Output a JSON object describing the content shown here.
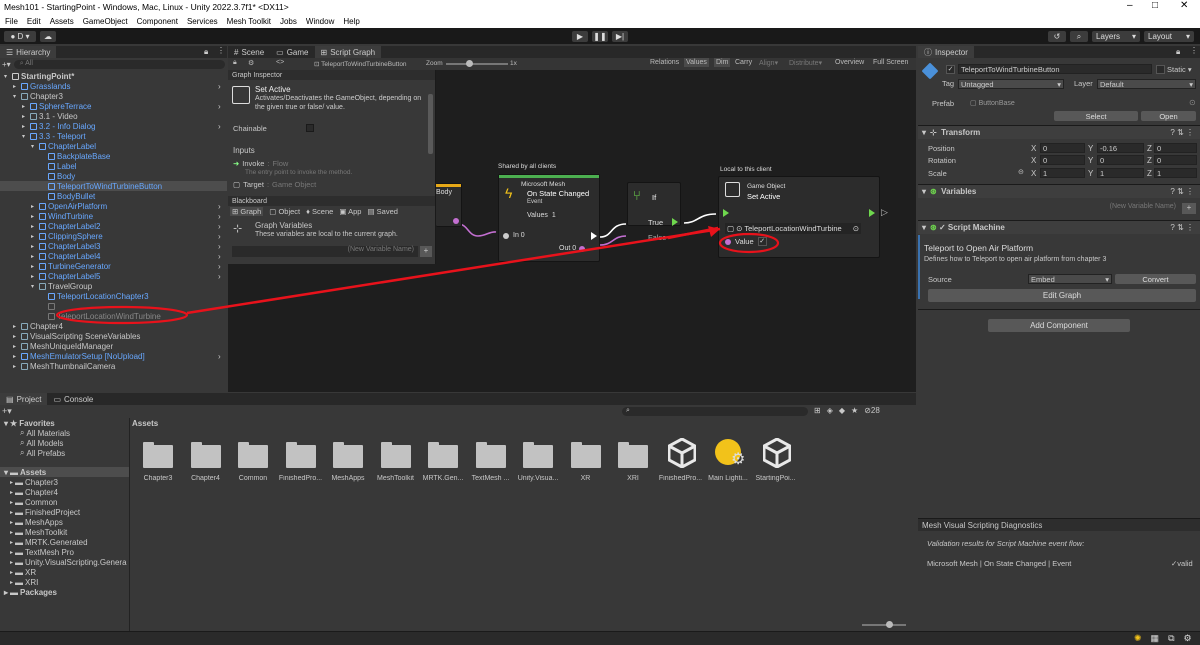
{
  "window": {
    "title": "Mesh101 - StartingPoint - Windows, Mac, Linux - Unity 2022.3.7f1* <DX11>",
    "min": "–",
    "max": "□",
    "close": "✕"
  },
  "menu": [
    "File",
    "Edit",
    "Assets",
    "GameObject",
    "Component",
    "Services",
    "Mesh Toolkit",
    "Jobs",
    "Window",
    "Help"
  ],
  "toolbar": {
    "account": "D",
    "layers": "Layers",
    "layout": "Layout"
  },
  "hierarchy": {
    "tab": "Hierarchy",
    "search_placeholder": "All",
    "rows": [
      {
        "label": "StartingPoint*",
        "indent": 0,
        "cls": "scene"
      },
      {
        "label": "Grasslands",
        "indent": 1,
        "cls": "blue"
      },
      {
        "label": "Chapter3",
        "indent": 1,
        "cls": ""
      },
      {
        "label": "SphereTerrace",
        "indent": 2,
        "cls": "blue"
      },
      {
        "label": "3.1 - Video",
        "indent": 2,
        "cls": ""
      },
      {
        "label": "3.2 - Info Dialog",
        "indent": 2,
        "cls": "blue"
      },
      {
        "label": "3.3 - Teleport",
        "indent": 2,
        "cls": "blue"
      },
      {
        "label": "ChapterLabel",
        "indent": 3,
        "cls": "blue"
      },
      {
        "label": "BackplateBase",
        "indent": 4,
        "cls": "blue"
      },
      {
        "label": "Label",
        "indent": 4,
        "cls": "blue"
      },
      {
        "label": "Body",
        "indent": 4,
        "cls": "blue"
      },
      {
        "label": "TeleportToWindTurbineButton",
        "indent": 4,
        "cls": "blue sel"
      },
      {
        "label": "BodyBullet",
        "indent": 4,
        "cls": "blue"
      },
      {
        "label": "OpenAirPlatform",
        "indent": 3,
        "cls": "blue"
      },
      {
        "label": "WindTurbine",
        "indent": 3,
        "cls": "blue"
      },
      {
        "label": "ChapterLabel2",
        "indent": 3,
        "cls": "blue"
      },
      {
        "label": "ClippingSphere",
        "indent": 3,
        "cls": "blue"
      },
      {
        "label": "ChapterLabel3",
        "indent": 3,
        "cls": "blue"
      },
      {
        "label": "ChapterLabel4",
        "indent": 3,
        "cls": "blue"
      },
      {
        "label": "TurbineGenerator",
        "indent": 3,
        "cls": "blue"
      },
      {
        "label": "ChapterLabel5",
        "indent": 3,
        "cls": "blue"
      },
      {
        "label": "TravelGroup",
        "indent": 3,
        "cls": ""
      },
      {
        "label": "TeleportLocationChapter3",
        "indent": 4,
        "cls": "blue"
      },
      {
        "label": "",
        "indent": 4,
        "cls": "gray"
      },
      {
        "label": "TeleportLocationWindTurbine",
        "indent": 4,
        "cls": "gray"
      },
      {
        "label": "Chapter4",
        "indent": 1,
        "cls": ""
      },
      {
        "label": "VisualScripting SceneVariables",
        "indent": 1,
        "cls": ""
      },
      {
        "label": "MeshUniqueIdManager",
        "indent": 1,
        "cls": ""
      },
      {
        "label": "MeshEmulatorSetup [NoUpload]",
        "indent": 1,
        "cls": "blue"
      },
      {
        "label": "MeshThumbnailCamera",
        "indent": 1,
        "cls": ""
      }
    ]
  },
  "center_tabs": {
    "scene": "Scene",
    "game": "Game",
    "script_graph": "Script Graph"
  },
  "graph_toolbar": {
    "breadcrumb": "TeleportToWindTurbineButton",
    "zoom_label": "Zoom",
    "zoom_value": "1x",
    "relations": "Relations",
    "values": "Values",
    "dim": "Dim",
    "carry": "Carry",
    "align": "Align",
    "distribute": "Distribute",
    "overview": "Overview",
    "fullscreen": "Full Screen"
  },
  "graph_inspector": {
    "header": "Graph Inspector",
    "node_title": "Set Active",
    "node_desc": "Activates/Deactivates the GameObject, depending on the given true or false/ value.",
    "chainable": "Chainable",
    "inputs": "Inputs",
    "invoke": "Invoke",
    "invoke_type": "Flow",
    "invoke_desc": "The entry point to invoke the method.",
    "target": "Target",
    "target_type": "Game Object"
  },
  "blackboard": {
    "header": "Blackboard",
    "tabs": [
      "Graph",
      "Object",
      "Scene",
      "App",
      "Saved"
    ],
    "title": "Graph Variables",
    "desc": "These variables are local to the current graph.",
    "new_var": "(New Variable Name)"
  },
  "nodes": {
    "partial_title": "Body",
    "shared_header": "Shared by all clients",
    "on_state": {
      "category": "Microsoft Mesh",
      "title": "On State Changed",
      "subtitle": "Event",
      "values_label": "Values",
      "values_count": "1",
      "in0": "In 0",
      "out0": "Out 0"
    },
    "if": {
      "title": "If",
      "true_label": "True",
      "false_label": "False"
    },
    "local_header": "Local to this client",
    "setactive": {
      "category": "Game Object",
      "title": "Set Active",
      "target": "TeleportLocationWindTurbine",
      "value_label": "Value"
    }
  },
  "inspector": {
    "tab": "Inspector",
    "object_name": "TeleportToWindTurbineButton",
    "static": "Static",
    "tag_label": "Tag",
    "tag": "Untagged",
    "layer_label": "Layer",
    "layer": "Default",
    "prefab_label": "Prefab",
    "prefab": "ButtonBase",
    "select": "Select",
    "open": "Open",
    "transform": {
      "header": "Transform",
      "position": "Position",
      "rotation": "Rotation",
      "scale": "Scale",
      "pos": [
        "0",
        "-0.16",
        "0"
      ],
      "rot": [
        "0",
        "0",
        "0"
      ],
      "scl": [
        "1",
        "1",
        "1"
      ],
      "x": "X",
      "y": "Y",
      "z": "Z"
    },
    "variables": {
      "header": "Variables",
      "new_var": "(New Variable Name)"
    },
    "script_machine": {
      "header": "Script Machine",
      "title": "Teleport to Open Air Platform",
      "desc": "Defines how to Teleport to open air platform from chapter 3",
      "source_label": "Source",
      "source": "Embed",
      "convert": "Convert",
      "edit_graph": "Edit Graph"
    },
    "add_component": "Add Component"
  },
  "diagnostics": {
    "header": "Mesh Visual Scripting Diagnostics",
    "subtitle": "Validation results for Script Machine event flow:",
    "row": "Microsoft Mesh | On State Changed | Event",
    "status": "valid"
  },
  "project": {
    "tab_project": "Project",
    "tab_console": "Console",
    "hidden_count": "28",
    "assets_header": "Assets",
    "favorites": "Favorites",
    "fav_items": [
      "All Materials",
      "All Models",
      "All Prefabs"
    ],
    "assets_root": "Assets",
    "asset_tree": [
      "Chapter3",
      "Chapter4",
      "Common",
      "FinishedProject",
      "MeshApps",
      "MeshToolkit",
      "MRTK.Generated",
      "TextMesh Pro",
      "Unity.VisualScripting.Genera",
      "XR",
      "XRI"
    ],
    "packages": "Packages",
    "grid": [
      "Chapter3",
      "Chapter4",
      "Common",
      "FinishedPro...",
      "MeshApps",
      "MeshToolkit",
      "MRTK.Gen...",
      "TextMesh ...",
      "Unity.Visua...",
      "XR",
      "XRI",
      "FinishedPro...",
      "Main Lighti...",
      "StartingPoi..."
    ]
  },
  "colors": {
    "accent": "#3a72b0",
    "annotation": "#e8121b",
    "flow": "#ffffff",
    "bool": "#c36fd1"
  }
}
